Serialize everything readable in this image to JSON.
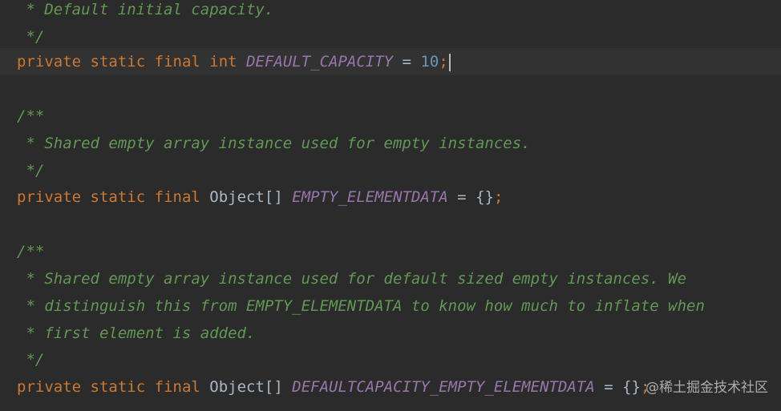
{
  "editor": {
    "lines": [
      {
        "kind": "comment",
        "text": " * Default initial capacity."
      },
      {
        "kind": "comment",
        "text": " */"
      },
      {
        "kind": "code",
        "tokens": {
          "mod1": "private",
          "mod2": "static",
          "mod3": "final",
          "type": "int",
          "name": "DEFAULT_CAPACITY",
          "eq": "=",
          "value": "10",
          "semi": ";"
        }
      },
      {
        "kind": "blank",
        "text": ""
      },
      {
        "kind": "comment",
        "text": "/**"
      },
      {
        "kind": "comment",
        "text": " * Shared empty array instance used for empty instances."
      },
      {
        "kind": "comment",
        "text": " */"
      },
      {
        "kind": "code",
        "tokens": {
          "mod1": "private",
          "mod2": "static",
          "mod3": "final",
          "type": "Object[]",
          "name": "EMPTY_ELEMENTDATA",
          "eq": "=",
          "value": "{}",
          "semi": ";"
        }
      },
      {
        "kind": "blank",
        "text": ""
      },
      {
        "kind": "comment",
        "text": "/**"
      },
      {
        "kind": "comment",
        "text": " * Shared empty array instance used for default sized empty instances. We"
      },
      {
        "kind": "comment",
        "text": " * distinguish this from EMPTY_ELEMENTDATA to know how much to inflate when"
      },
      {
        "kind": "comment",
        "text": " * first element is added."
      },
      {
        "kind": "comment",
        "text": " */"
      },
      {
        "kind": "code",
        "tokens": {
          "mod1": "private",
          "mod2": "static",
          "mod3": "final",
          "type": "Object[]",
          "name": "DEFAULTCAPACITY_EMPTY_ELEMENTDATA",
          "eq": "=",
          "value": "{}",
          "semi": ";"
        }
      }
    ]
  },
  "watermark": {
    "text": "@稀土掘金技术社区"
  },
  "colors": {
    "background": "#2b2b2b",
    "current_line": "#323232",
    "comment": "#629755",
    "keyword": "#cc7832",
    "constant": "#9876aa",
    "number": "#6897bb",
    "text": "#a9b7c6"
  }
}
